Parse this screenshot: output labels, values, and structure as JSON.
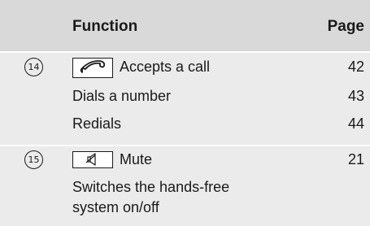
{
  "header": {
    "function_label": "Function",
    "page_label": "Page"
  },
  "rows": [
    {
      "number": "14",
      "items": [
        {
          "key_icon": "phone-handset-icon",
          "text": "Accepts a call",
          "page": "42"
        },
        {
          "text": "Dials a number",
          "page": "43"
        },
        {
          "text": "Redials",
          "page": "44"
        }
      ]
    },
    {
      "number": "15",
      "items": [
        {
          "key_icon": "mute-speaker-icon",
          "text": "Mute",
          "page": "21"
        },
        {
          "text": "Switches the hands-free system on/off",
          "text_lines": [
            "Switches the hands-free",
            "system on/off"
          ],
          "page": ""
        }
      ]
    }
  ]
}
